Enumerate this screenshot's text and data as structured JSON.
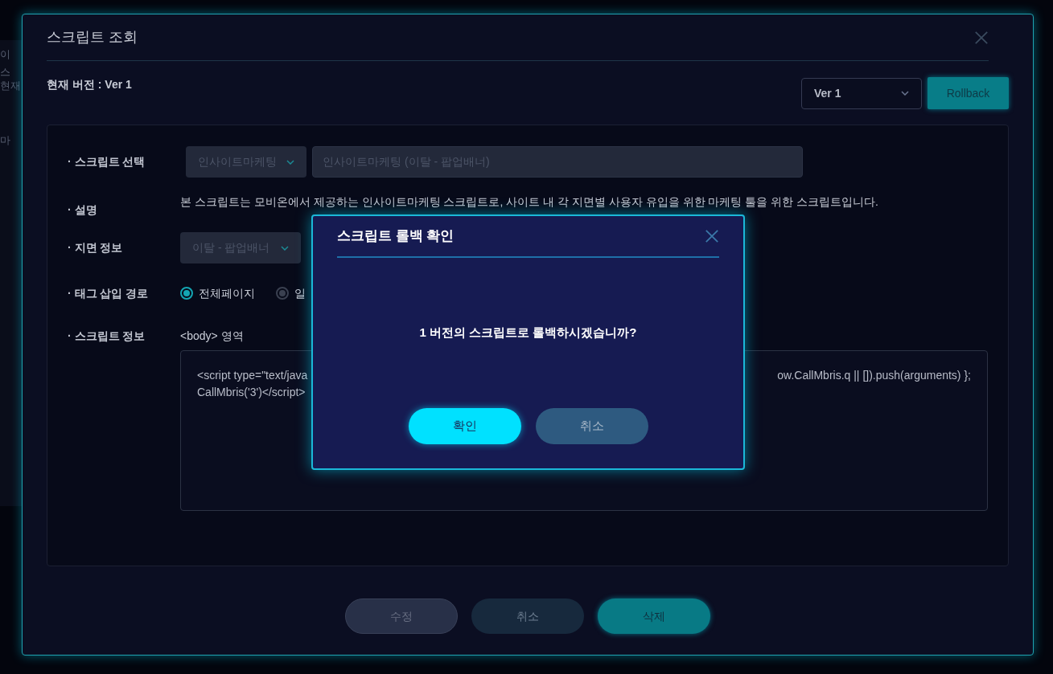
{
  "background": {
    "fragments": [
      "이",
      "스",
      "현재",
      "마"
    ]
  },
  "modal": {
    "title": "스크립트 조회",
    "current_version": "현재 버전 : Ver 1",
    "version_select": {
      "value": "Ver 1"
    },
    "rollback_button": "Rollback",
    "fields": [
      {
        "kind": "select_input",
        "label": "· 스크립트 선택",
        "select": {
          "value": "인사이트마케팅",
          "disabled": true
        },
        "input": {
          "value": "인사이트마케팅 (이탈 - 팝업배너)",
          "disabled": true
        }
      },
      {
        "kind": "text",
        "label": "· 설명",
        "text": "본 스크립트는 모비온에서 제공하는 인사이트마케팅 스크립트로, 사이트 내 각 지면별 사용자 유입을 위한 마케팅 툴을 위한 스크립트입니다."
      },
      {
        "kind": "select",
        "label": "· 지면 정보",
        "select": {
          "value": "이탈 - 팝업배너",
          "disabled": true
        }
      },
      {
        "kind": "radios",
        "label": "· 태그 삽입 경로",
        "options": [
          {
            "label": "전체페이지",
            "selected": true
          },
          {
            "label": "일",
            "selected": false
          }
        ]
      },
      {
        "kind": "code",
        "label": "· 스크립트 정보",
        "caption": "<body> 영역",
        "lines": [
          {
            "left": "<script type=\"text/java",
            "right": "ow.CallMbris.q || []).push(arguments) };"
          },
          {
            "left": "CallMbris('3')</script>"
          }
        ]
      }
    ],
    "buttons": [
      {
        "label": "수정",
        "kind": "outline",
        "disabled": true
      },
      {
        "label": "취소",
        "kind": "secondary",
        "disabled": false
      },
      {
        "label": "삭제",
        "kind": "primary",
        "disabled": false
      }
    ]
  },
  "confirm": {
    "title": "스크립트 롤백 확인",
    "message": "1 버전의 스크립트로 롤백하시겠습니까?",
    "buttons": [
      {
        "label": "확인",
        "kind": "primary"
      },
      {
        "label": "취소",
        "kind": "secondary"
      }
    ]
  }
}
